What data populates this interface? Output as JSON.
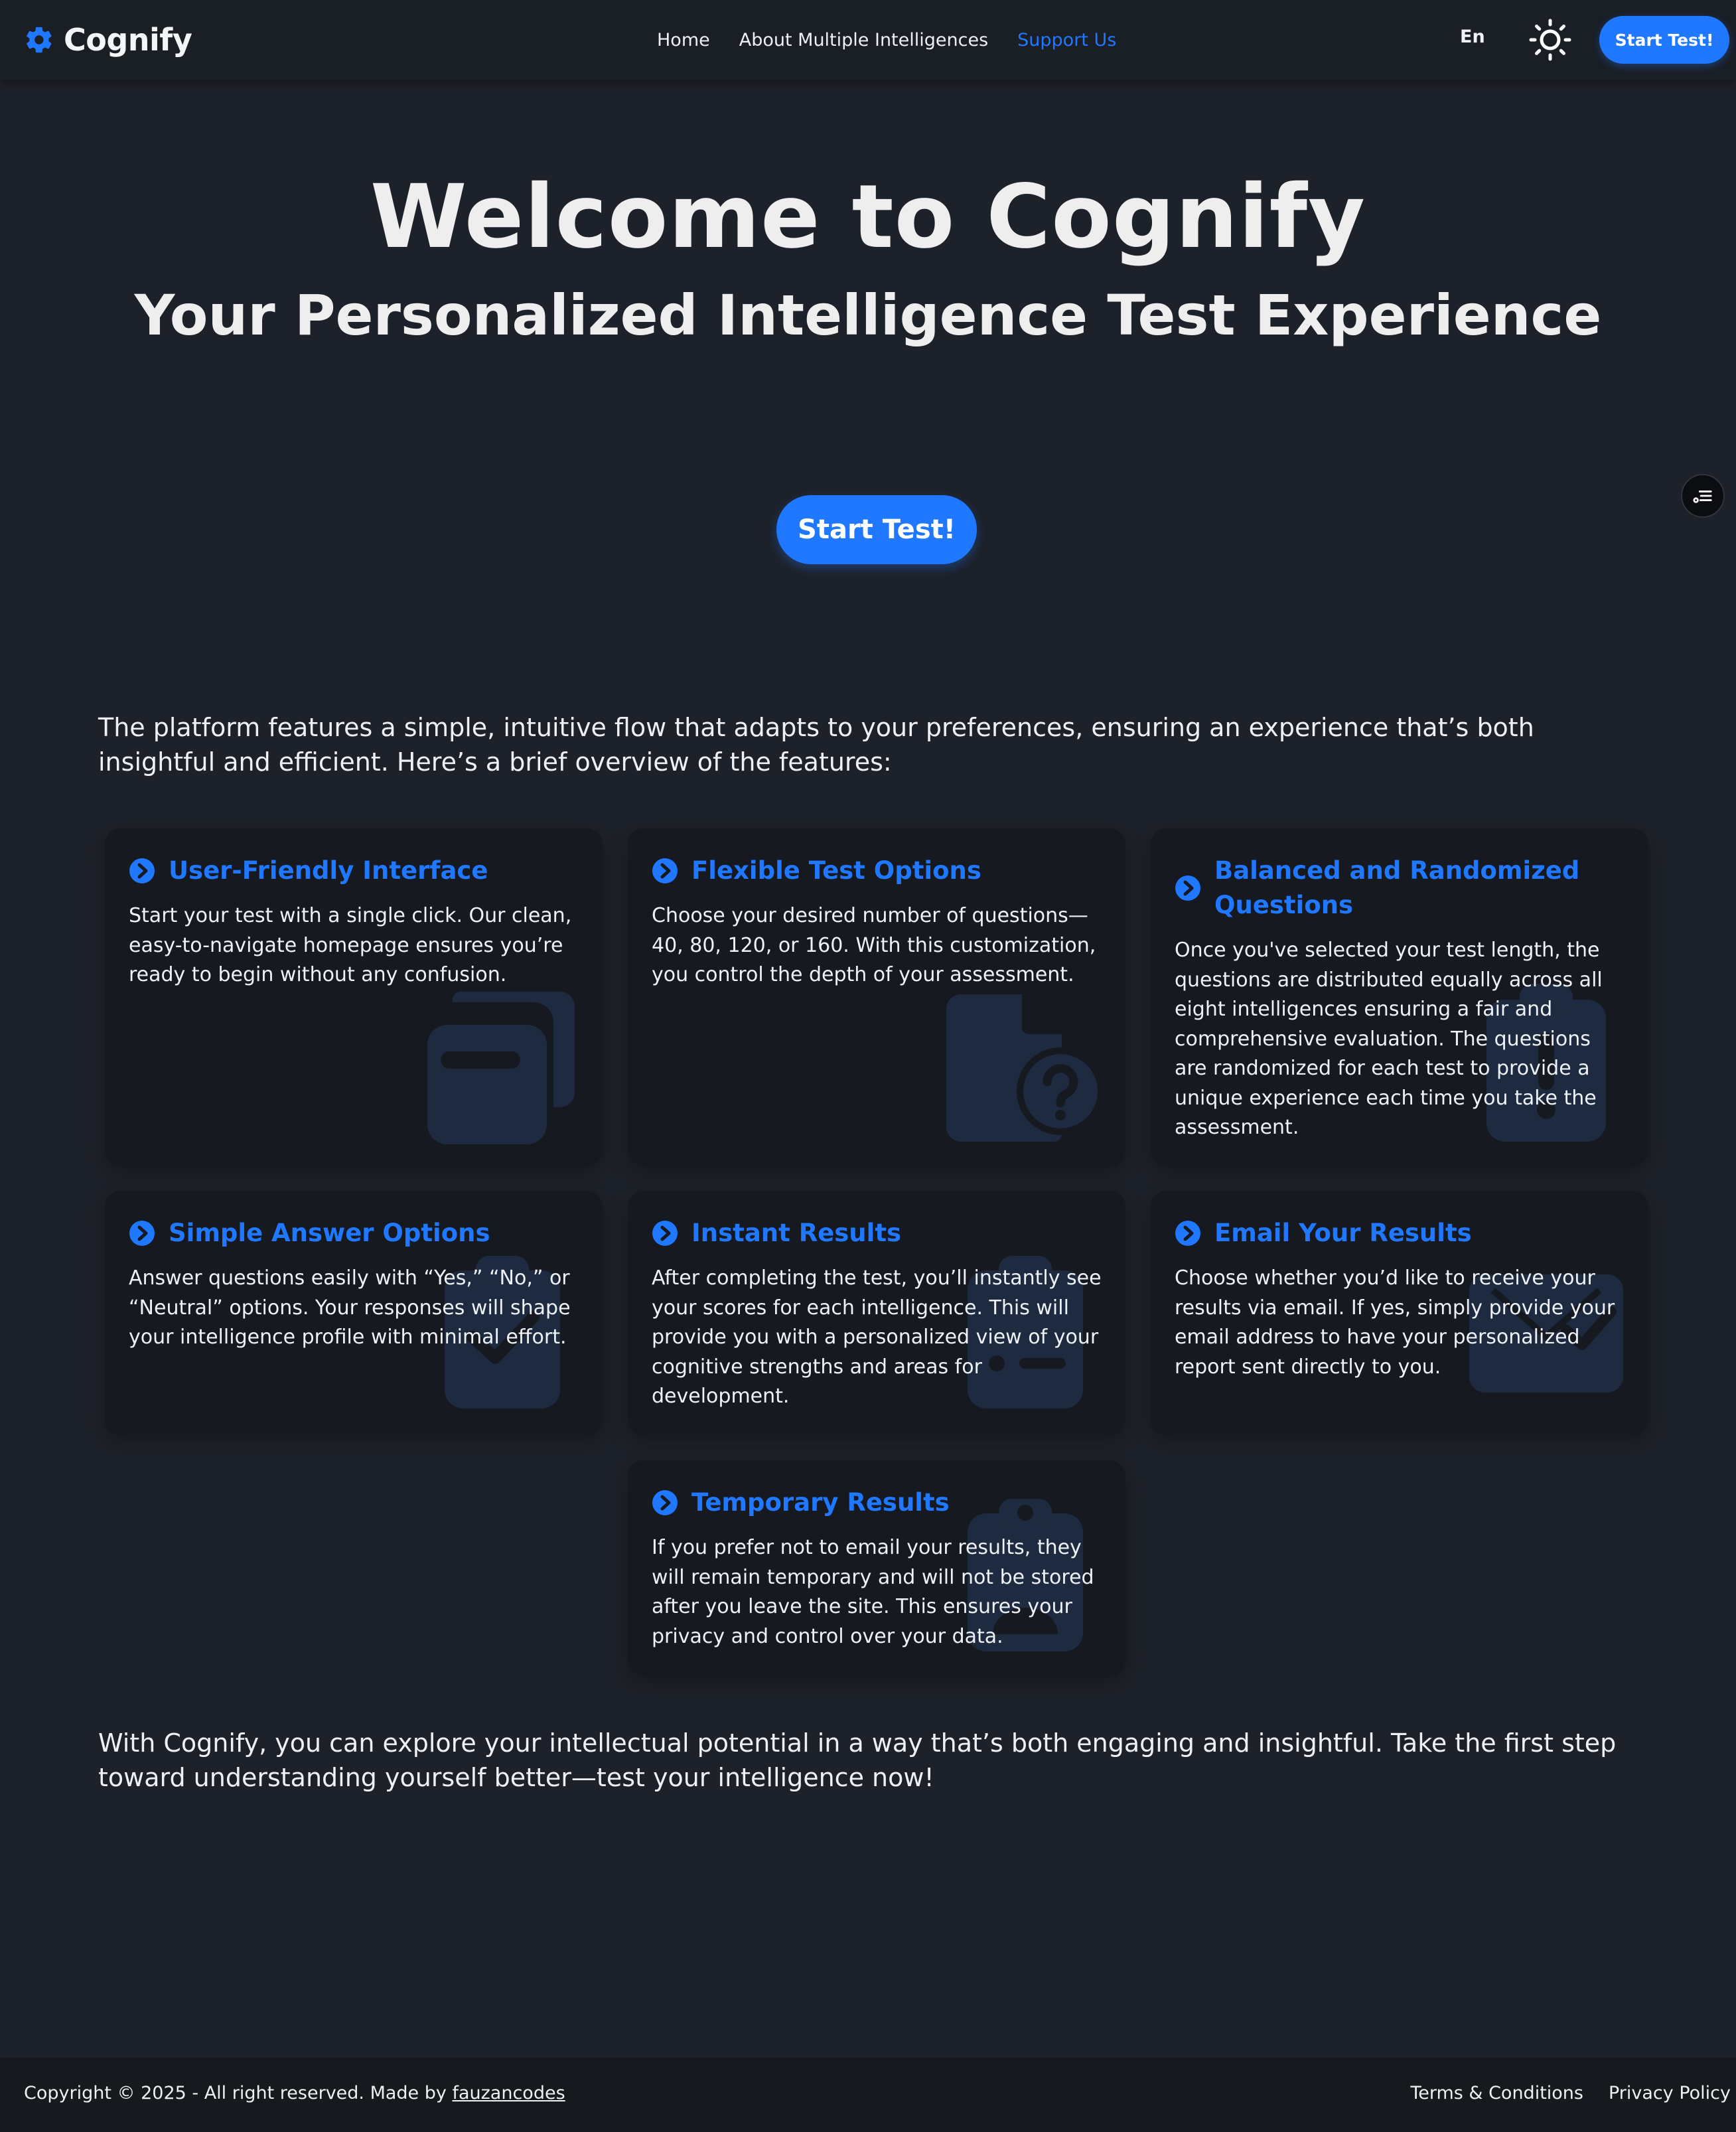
{
  "header": {
    "brand": "Cognify",
    "nav": [
      "Home",
      "About Multiple Intelligences",
      "Support Us"
    ],
    "active_nav": "Support Us",
    "language": "En",
    "cta_label": "Start Test!",
    "icons": {
      "logo": "gear-icon",
      "theme": "sun-icon"
    }
  },
  "hero": {
    "title": "Welcome to Cognify",
    "subtitle": "Your Personalized Intelligence Test Experience",
    "cta_label": "Start Test!"
  },
  "intro": "The platform features a simple, intuitive flow that adapts to your preferences, ensuring an experience that’s both insightful and efficient. Here’s a brief overview of the features:",
  "features": [
    {
      "title": "User-Friendly Interface",
      "text": "Start your test with a single click. Our clean, easy-to-navigate homepage ensures you’re ready to begin without any confusion.",
      "icon": "window-restore-icon"
    },
    {
      "title": "Flexible Test Options",
      "text": "Choose your desired number of questions—40, 80, 120, or 160. With this customization, you control the depth of your assessment.",
      "icon": "file-question-icon"
    },
    {
      "title": "Balanced and Randomized Questions",
      "text": "Once you've selected your test length, the questions are distributed equally across all eight intelligences ensuring a fair and comprehensive evaluation. The questions are randomized for each test to provide a unique experience each time you take the assessment.",
      "icon": "clipboard-alert-icon"
    },
    {
      "title": "Simple Answer Options",
      "text": "Answer questions easily with “Yes,” “No,” or “Neutral” options. Your responses will shape your intelligence profile with minimal effort.",
      "icon": "clipboard-check-icon"
    },
    {
      "title": "Instant Results",
      "text": "After completing the test, you’ll instantly see your scores for each intelligence. This will provide you with a personalized view of your cognitive strengths and areas for development.",
      "icon": "clipboard-list-icon"
    },
    {
      "title": "Email Your Results",
      "text": "Choose whether you’d like to receive your results via email. If yes, simply provide your email address to have your personalized report sent directly to you.",
      "icon": "envelope-check-icon"
    },
    {
      "title": "Temporary Results",
      "text": "If you prefer not to email your results, they will remain temporary and will not be stored after you leave the site. This ensures your privacy and control over your data.",
      "icon": "clipboard-user-icon"
    }
  ],
  "outro": "With Cognify, you can explore your intellectual potential in a way that’s both engaging and insightful. Take the first step toward understanding yourself better—test your intelligence now!",
  "footer": {
    "copyright": "Copyright © 2025 - All right reserved. Made by",
    "author": "fauzancodes",
    "links": [
      "Terms & Conditions",
      "Privacy Policy"
    ]
  },
  "colors": {
    "accent": "#1f78ff",
    "background": "#1d2129",
    "card": "#16191f",
    "text": "#eceff3"
  }
}
